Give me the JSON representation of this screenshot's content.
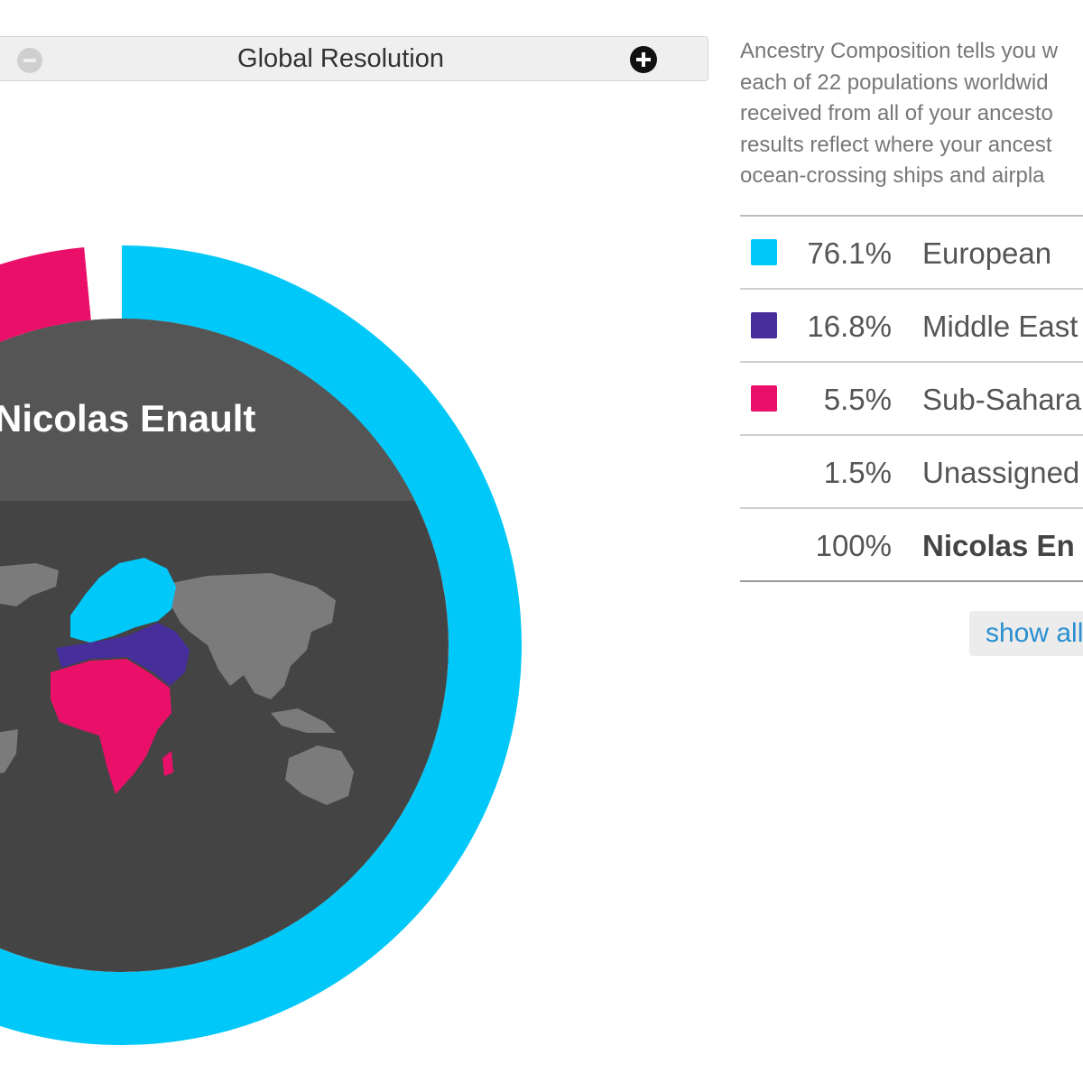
{
  "resolution": {
    "title": "Global Resolution"
  },
  "description": {
    "lines": [
      "Ancestry Composition tells you w",
      "each of 22 populations worldwid",
      "received from all of your ancesto",
      "results reflect where your ancest",
      "ocean-crossing ships and airpla"
    ]
  },
  "donut": {
    "name": "Nicolas Enault"
  },
  "legend": {
    "rows": [
      {
        "pct": "76.1%",
        "label": "European",
        "color": "#00c8f8"
      },
      {
        "pct": "16.8%",
        "label": "Middle East",
        "color": "#462e9b"
      },
      {
        "pct": "5.5%",
        "label": "Sub-Sahara",
        "color": "#ea1069"
      },
      {
        "pct": "1.5%",
        "label": "Unassigned",
        "color": ""
      }
    ],
    "total": {
      "pct": "100%",
      "label": "Nicolas En"
    }
  },
  "show_all": "show all",
  "chart_data": {
    "type": "pie",
    "categories": [
      "European",
      "Middle East",
      "Sub-Sahara",
      "Unassigned"
    ],
    "values": [
      76.1,
      16.8,
      5.5,
      1.5
    ],
    "colors": [
      "#00c8f8",
      "#462e9b",
      "#ea1069",
      "#ffffff"
    ],
    "title": "Nicolas Enault"
  }
}
